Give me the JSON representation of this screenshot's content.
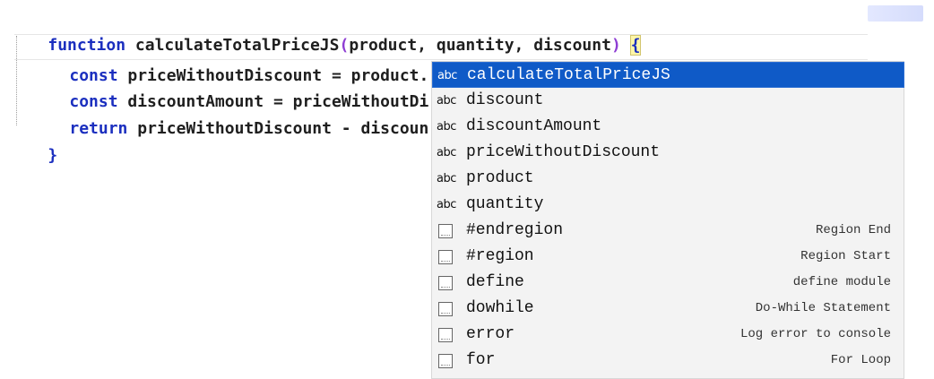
{
  "editor": {
    "line1": {
      "keyword": "function",
      "name": " calculateTotalPriceJS",
      "paren_open": "(",
      "params": "product, quantity, discount",
      "paren_close": ")",
      "space": " ",
      "brace": "{"
    },
    "line2": {
      "keyword": "const",
      "rest": " priceWithoutDiscount = product. * quantity;"
    },
    "line3": {
      "keyword": "const",
      "rest": " discountAmount = priceWithoutDi"
    },
    "line4": {
      "keyword": "return",
      "rest": " priceWithoutDiscount - discoun"
    },
    "line5": {
      "brace": "}"
    }
  },
  "suggestions": [
    {
      "kind": "abc",
      "label": "calculateTotalPriceJS",
      "hint": "",
      "selected": true
    },
    {
      "kind": "abc",
      "label": "discount",
      "hint": "",
      "selected": false
    },
    {
      "kind": "abc",
      "label": "discountAmount",
      "hint": "",
      "selected": false
    },
    {
      "kind": "abc",
      "label": "priceWithoutDiscount",
      "hint": "",
      "selected": false
    },
    {
      "kind": "abc",
      "label": "product",
      "hint": "",
      "selected": false
    },
    {
      "kind": "abc",
      "label": "quantity",
      "hint": "",
      "selected": false
    },
    {
      "kind": "snippet",
      "label": "#endregion",
      "hint": "Region End",
      "selected": false
    },
    {
      "kind": "snippet",
      "label": "#region",
      "hint": "Region Start",
      "selected": false
    },
    {
      "kind": "snippet",
      "label": "define",
      "hint": "define module",
      "selected": false
    },
    {
      "kind": "snippet",
      "label": "dowhile",
      "hint": "Do-While Statement",
      "selected": false
    },
    {
      "kind": "snippet",
      "label": "error",
      "hint": "Log error to console",
      "selected": false
    },
    {
      "kind": "snippet",
      "label": "for",
      "hint": "For Loop",
      "selected": false
    }
  ],
  "icons": {
    "abc_text": "abc",
    "snippet_icon": "snippet-icon",
    "word_icon": "word-icon"
  },
  "colors": {
    "keyword": "#1b2fbf",
    "selection": "#0f5ac7",
    "dropdown_bg": "#f3f3f3"
  }
}
